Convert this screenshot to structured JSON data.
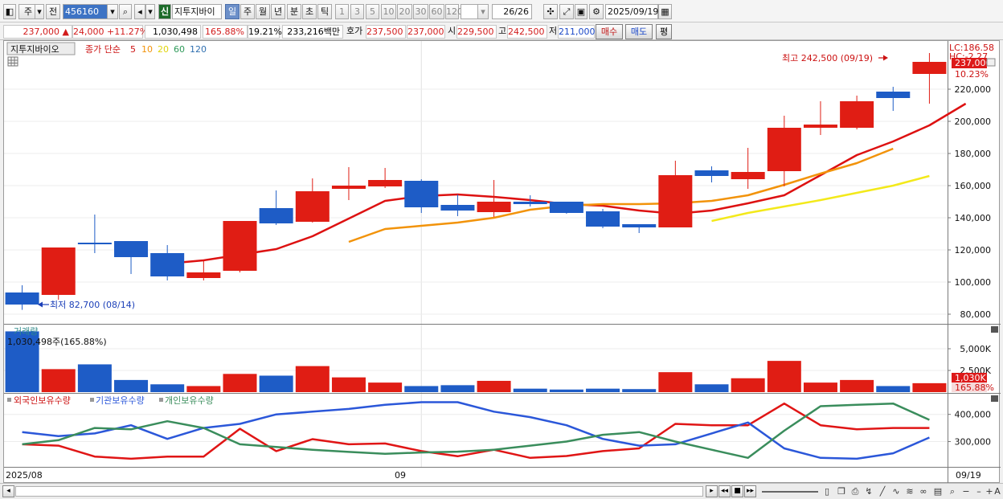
{
  "toolbar": {
    "period_type": "주",
    "all_label": "전",
    "code": "456160",
    "shin_label": "신",
    "stock_name": "지투지바이",
    "periods": [
      "일",
      "주",
      "월",
      "년",
      "분",
      "초",
      "틱"
    ],
    "selected_period": "일",
    "intervals": [
      "1",
      "3",
      "5",
      "10",
      "20",
      "30",
      "60",
      "120"
    ],
    "count": "26/26",
    "date": "2025/09/19"
  },
  "quote": {
    "price": "237,000",
    "change_arrow": "▲",
    "change": "24,000",
    "change_pct": "+11.27%",
    "volume": "1,030,498",
    "volume_ratio": "165.88%",
    "turnover": "19.21%",
    "amount": "233,216백만",
    "bid_label": "호가",
    "bid": "237,500",
    "ask": "237,000",
    "open_label": "시",
    "open": "229,500",
    "high_label": "고",
    "high": "242,500",
    "low_label": "저",
    "low": "211,000",
    "buy_label": "매수",
    "sell_label": "매도",
    "flat_label": "평"
  },
  "legend": {
    "stock_button": "지투지바이오",
    "ma_prefix": "종가 단순",
    "ma_periods": [
      "5",
      "10",
      "20",
      "60",
      "120"
    ]
  },
  "annotations": {
    "high": "최고 242,500 (09/19)",
    "low": "최저 82,700 (08/14)",
    "lc": "LC:186.58",
    "hc": "HC:-2.27",
    "last_price": "237,000",
    "last_pct": "10.23%"
  },
  "volume_panel": {
    "title": "거래량",
    "readout": "1,030,498주(165.88%)",
    "last_value": "1,030K",
    "last_pct": "165.88%"
  },
  "holdings_panel": {
    "series_names": [
      "외국인보유수량",
      "기관보유수량",
      "개인보유수량"
    ]
  },
  "xaxis": {
    "start_label": "2025/08",
    "mid_label": "09",
    "end_label": "09/19"
  },
  "chart_data": [
    {
      "type": "candlestick",
      "ylim": [
        75000,
        248000
      ],
      "yticks": [
        80000,
        100000,
        120000,
        140000,
        160000,
        180000,
        200000,
        220000
      ],
      "ytick_labels": [
        "80,000",
        "100,000",
        "120,000",
        "140,000",
        "160,000",
        "180,000",
        "200,000",
        "220,000"
      ],
      "candles": [
        {
          "o": 93500,
          "h": 98000,
          "l": 82700,
          "c": 86000
        },
        {
          "o": 92000,
          "h": 121500,
          "l": 89000,
          "c": 121500
        },
        {
          "o": 124500,
          "h": 142000,
          "l": 118000,
          "c": 123500
        },
        {
          "o": 125500,
          "h": 125500,
          "l": 105000,
          "c": 115500
        },
        {
          "o": 118000,
          "h": 123000,
          "l": 101000,
          "c": 103500
        },
        {
          "o": 102500,
          "h": 113000,
          "l": 101000,
          "c": 106000
        },
        {
          "o": 107000,
          "h": 138000,
          "l": 106000,
          "c": 138000
        },
        {
          "o": 146000,
          "h": 157000,
          "l": 135500,
          "c": 136500
        },
        {
          "o": 137500,
          "h": 164500,
          "l": 137000,
          "c": 156500
        },
        {
          "o": 158000,
          "h": 171500,
          "l": 151000,
          "c": 160000
        },
        {
          "o": 159500,
          "h": 171000,
          "l": 158500,
          "c": 163500
        },
        {
          "o": 163000,
          "h": 164000,
          "l": 143000,
          "c": 146500
        },
        {
          "o": 148000,
          "h": 154500,
          "l": 141000,
          "c": 144500
        },
        {
          "o": 143500,
          "h": 163500,
          "l": 140500,
          "c": 150000
        },
        {
          "o": 150000,
          "h": 154000,
          "l": 147000,
          "c": 148500
        },
        {
          "o": 150000,
          "h": 150000,
          "l": 142500,
          "c": 143000
        },
        {
          "o": 144000,
          "h": 145500,
          "l": 133500,
          "c": 134500
        },
        {
          "o": 136000,
          "h": 136000,
          "l": 130500,
          "c": 134000
        },
        {
          "o": 134000,
          "h": 175500,
          "l": 134000,
          "c": 166500
        },
        {
          "o": 169500,
          "h": 172000,
          "l": 162000,
          "c": 166000
        },
        {
          "o": 164000,
          "h": 183500,
          "l": 158000,
          "c": 168500
        },
        {
          "o": 169000,
          "h": 203500,
          "l": 159500,
          "c": 196000
        },
        {
          "o": 196000,
          "h": 212500,
          "l": 191500,
          "c": 198000
        },
        {
          "o": 196000,
          "h": 216000,
          "l": 195000,
          "c": 212500
        },
        {
          "o": 218500,
          "h": 221500,
          "l": 206500,
          "c": 214500
        },
        {
          "o": 229500,
          "h": 242500,
          "l": 211000,
          "c": 237000
        }
      ],
      "moving_averages": [
        {
          "period": "5",
          "color": "#dd1111",
          "start": 4,
          "values": [
            111500,
            113500,
            117000,
            120500,
            128500,
            139500,
            150500,
            153500,
            154500,
            153000,
            151000,
            148500,
            147500,
            144500,
            142500,
            144500,
            149000,
            154000,
            166500,
            179000,
            187500,
            197500,
            211000
          ]
        },
        {
          "period": "10",
          "color": "#f2930a",
          "start": 9,
          "values": [
            125000,
            133000,
            135000,
            137000,
            140000,
            145000,
            147500,
            148500,
            148500,
            149000,
            150500,
            154000,
            160500,
            167500,
            174000,
            183000
          ]
        },
        {
          "period": "20",
          "color": "#f3e91a",
          "start": 19,
          "values": [
            138000,
            143000,
            147000,
            151000,
            155500,
            160000,
            166000
          ]
        }
      ]
    },
    {
      "type": "bar",
      "title": "거래량",
      "ylim": [
        0,
        7500
      ],
      "yticks": [
        2500,
        5000
      ],
      "ytick_labels": [
        "2,500K",
        "5,000K"
      ],
      "values": [
        7000,
        2650,
        3200,
        1400,
        900,
        700,
        2100,
        1900,
        3000,
        1700,
        1100,
        700,
        800,
        1300,
        400,
        300,
        400,
        350,
        2300,
        900,
        1600,
        3600,
        1100,
        1400,
        700,
        1030
      ]
    },
    {
      "type": "line",
      "ylim": [
        210000,
        470000
      ],
      "yticks": [
        300000,
        400000
      ],
      "ytick_labels": [
        "300,000",
        "400,000"
      ],
      "series": [
        {
          "name": "외국인보유수량",
          "color": "#e01515",
          "values": [
            290000,
            285000,
            245000,
            237000,
            245000,
            245000,
            347000,
            265000,
            309000,
            290000,
            293000,
            265000,
            246000,
            270000,
            240000,
            247000,
            265000,
            275000,
            365000,
            360000,
            360000,
            440000,
            360000,
            345000,
            350000,
            350000
          ]
        },
        {
          "name": "기관보유수량",
          "color": "#2b57d9",
          "values": [
            335000,
            320000,
            330000,
            360000,
            310000,
            350000,
            365000,
            400000,
            410000,
            420000,
            435000,
            445000,
            445000,
            410000,
            390000,
            360000,
            310000,
            285000,
            290000,
            330000,
            370000,
            275000,
            240000,
            237000,
            257000,
            315000
          ]
        },
        {
          "name": "개인보유수량",
          "color": "#3a8d5c",
          "values": [
            290000,
            305000,
            350000,
            345000,
            375000,
            350000,
            290000,
            280000,
            270000,
            262000,
            255000,
            260000,
            263000,
            270000,
            285000,
            300000,
            325000,
            335000,
            300000,
            270000,
            240000,
            340000,
            430000,
            435000,
            440000,
            380000
          ]
        }
      ]
    }
  ]
}
